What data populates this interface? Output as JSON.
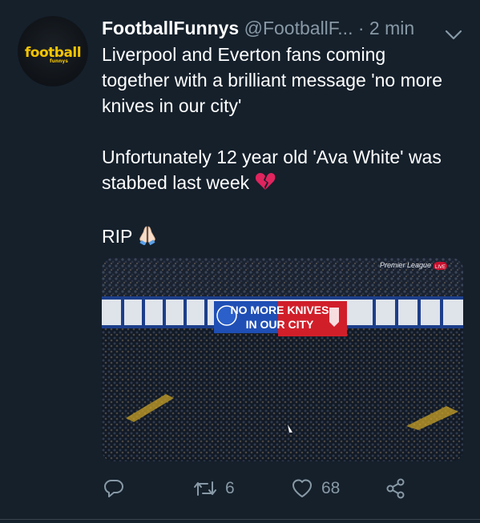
{
  "avatar": {
    "logo_text": "football",
    "logo_sub": "funnys"
  },
  "header": {
    "display_name": "FootballFunnys",
    "handle": "@FootballF...",
    "time": "· 2 min"
  },
  "tweet": {
    "line1": "Liverpool and Everton fans coming together with a brilliant message 'no more  knives in our city'",
    "line2": "Unfortunately 12 year old 'Ava White' was stabbed last week",
    "line3": "RIP"
  },
  "media": {
    "banner_text_1": "NO MORE KNIVES",
    "banner_text_2": "IN OUR CITY",
    "broadcaster": "Premier League",
    "live_badge": "LIVE"
  },
  "actions": {
    "retweets": "6",
    "likes": "68"
  },
  "colors": {
    "background": "#15202b",
    "secondary_text": "#8899a6",
    "banner_blue": "#1f4fb5",
    "banner_red": "#d11f2a",
    "logo_yellow": "#f5c400"
  },
  "icons": [
    "caret-down-icon",
    "broken-heart-icon",
    "praying-hands-icon",
    "reply-icon",
    "retweet-icon",
    "like-icon",
    "share-icon"
  ]
}
